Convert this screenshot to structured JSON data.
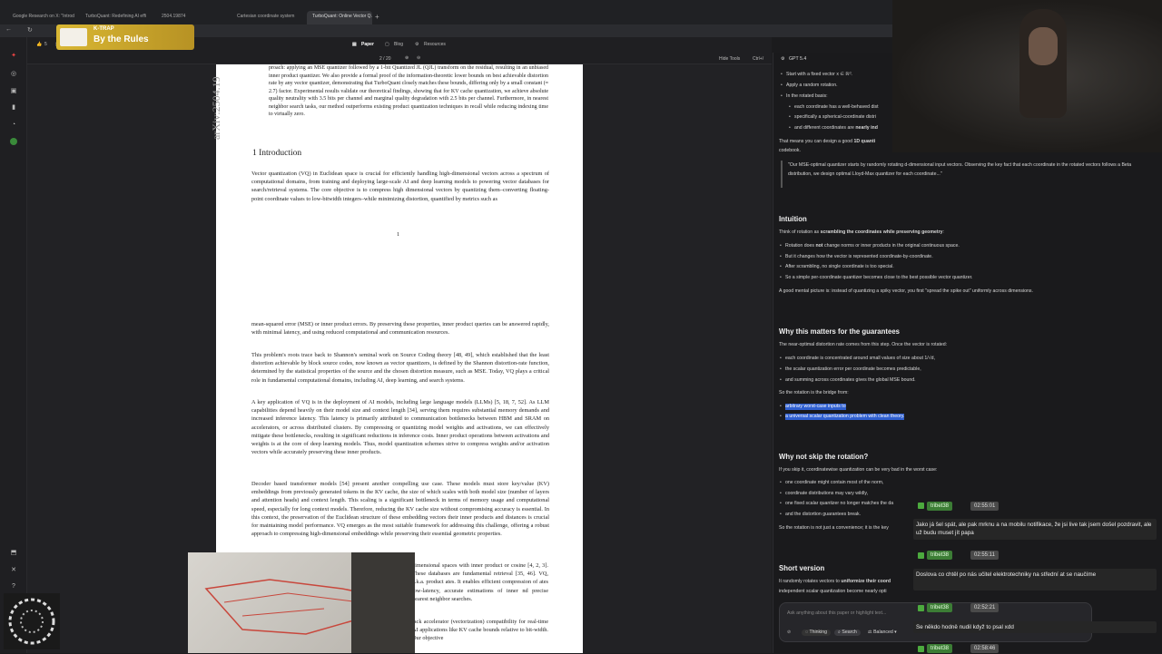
{
  "browser": {
    "tabs": [
      {
        "label": "Google Research on X: \"Introd"
      },
      {
        "label": "TurboQuant: Redefining AI effi"
      },
      {
        "label": "2504.19874"
      },
      {
        "label": "Cartesian coordinate system"
      },
      {
        "label": "TurboQuant: Online Vector Q..."
      }
    ],
    "new_tab_label": "+"
  },
  "overlay": {
    "brand": "K-TRAP",
    "subtitle": "By the Rules"
  },
  "viewer": {
    "tabs": [
      "Paper",
      "Blog",
      "Resources"
    ],
    "page_indicator": "2 / 20",
    "toolbar_count": "5",
    "hide_tools": "Hide Tools",
    "hide_tools_shortcut": "Ctrl+/",
    "arxiv_stamp": "arXiv:2504.19"
  },
  "paper": {
    "abstract_tail": "proach: applying an MSE quantizer followed by a 1-bit Quantized JL (QJL) transform on the residual, resulting in an unbiased inner product quantizer. We also provide a formal proof of the information-theoretic lower bounds on best achievable distortion rate by any vector quantizer, demonstrating that TurboQuant closely matches these bounds, differing only by a small constant (≈ 2.7) factor. Experimental results validate our theoretical findings, showing that for KV cache quantization, we achieve absolute quality neutrality with 3.5 bits per channel and marginal quality degradation with 2.5 bits per channel. Furthermore, in nearest neighbor search tasks, our method outperforms existing product quantization techniques in recall while reducing indexing time to virtually zero.",
    "section_title": "1   Introduction",
    "intro_p1": "Vector quantization (VQ) in Euclidean space is crucial for efficiently handling high-dimensional vectors across a spectrum of computational domains, from training and deploying large-scale AI and deep learning models to powering vector databases for search/retrieval systems. The core objective is to compress high dimensional vectors by quantizing them–converting floating-point coordinate values to low-bitwidth integers–while minimizing distortion, quantified by metrics such as",
    "page_number": "1",
    "p2": "mean-squared error (MSE) or inner product errors. By preserving these properties, inner product queries can be answered rapidly, with minimal latency, and using reduced computational and communication resources.",
    "p3": "This problem's roots trace back to Shannon's seminal work on Source Coding theory [48, 49], which established that the least distortion achievable by block source codes, now known as vector quantizers, is defined by the Shannon distortion-rate function, determined by the statistical properties of the source and the chosen distortion measure, such as MSE. Today, VQ plays a critical role in fundamental computational domains, including AI, deep learning, and search systems.",
    "p4": "A key application of VQ is in the deployment of AI models, including large language models (LLMs) [5, 18, 7, 52]. As LLM capabilities depend heavily on their model size and context length [34], serving them requires substantial memory demands and increased inference latency. This latency is primarily attributed to communication bottlenecks between HBM and SRAM on accelerators, or across distributed clusters. By compressing or quantizing model weights and activations, we can effectively mitigate these bottlenecks, resulting in significant reductions in inference costs. Inner product operations between activations and weights is at the core of deep learning models. Thus, model quantization schemes strive to compress weights and/or activation vectors while accurately preserving these inner products.",
    "p5": "Decoder based transformer models [54] present another compelling use case. These models must store key/value (KV) embeddings from previously generated tokens in the KV cache, the size of which scales with both model size (number of layers and attention heads) and context length. This scaling is a significant bottleneck in terms of memory usage and computational speed, especially for long context models. Therefore, reducing the KV cache size without compromising accuracy is essential. In this context, the preservation of the Euclidean structure of these embedding vectors their inner products and distances is crucial for maintaining model performance. VQ emerges as the most suitable framework for addressing this challenge, offering a robust approach to compressing high-dimensional embeddings while preserving their essential geometric properties.",
    "p6": "dimensional spaces with inner product or cosine [4, 2, 3]. These databases are fundamental retrieval [35, 46]. VQ, a.k.a. product ates. It enables efficient compression of ates low-latency, accurate estimations of inner nd precise nearest neighbor searches.",
    "p7": "lack accelerator (vectorization) compatibility for real-time AI applications like KV cache bounds relative to bit-width. Our objective"
  },
  "chat": {
    "model": "GPT 5.4",
    "l1": "Start with a fixed vector x ∈ ℝᵈ.",
    "l2": "Apply a random rotation.",
    "l3": "In the rotated basis:",
    "l4": "each coordinate has a well-behaved dist",
    "l5": "specifically a spherical-coordinate distri",
    "l6a": "and different coordinates are ",
    "l6b": "nearly ind",
    "l7a": "That means you can design a good ",
    "l7b": "1D quanti",
    "l8": "codebook.",
    "quote": "\"Our MSE-optimal quantizer starts by randomly rotating d-dimensional input vectors. Observing the key fact that each coordinate in the rotated vectors follows a Beta distribution, we design optimal Lloyd-Max quantizer for each coordinate...\"",
    "h_intuition": "Intuition",
    "i1a": "Think of rotation as ",
    "i1b": "scrambling the coordinates while preserving geometry",
    "i1c": ":",
    "i2a": "Rotation does ",
    "i2b": "not",
    "i2c": " change norms or inner products in the original continuous space.",
    "i3": "But it changes how the vector is represented coordinate-by-coordinate.",
    "i4": "After scrambling, no single coordinate is too special.",
    "i5": "So a simple per-coordinate quantizer becomes close to the best possible vector quantizer.",
    "i6": "A good mental picture is: instead of quantizing a spiky vector, you first \"spread the spike out\" uniformly across dimensions.",
    "h_why": "Why this matters for the guarantees",
    "w1": "The near-optimal distortion rate comes from this step. Once the vector is rotated:",
    "w2": "each coordinate is concentrated around small values of size about 1/√d,",
    "w3": "the scalar quantization error per coordinate becomes predictable,",
    "w4": "and summing across coordinates gives the global MSE bound.",
    "w5": "So the rotation is the bridge from:",
    "w6": "arbitrary worst-case inputs to",
    "w7": "a universal scalar quantization problem with clean theory.",
    "h_skip": "Why not skip the rotation?",
    "s1": "If you skip it, coordinatewise quantization can be very bad in the worst case:",
    "s2": "one coordinate might contain most of the norm,",
    "s3": "coordinate distributions may vary wildly,",
    "s4": "one fixed scalar quantizer no longer matches the da",
    "s5": "and the distortion guarantees break.",
    "s6": "So the rotation is not just a convenience; it is the key",
    "h_short": "Short version",
    "sv1a": "It randomly rotates vectors to ",
    "sv1b": "uniformize their coord",
    "sv2": "independent scalar quantization become nearly opti",
    "ask_placeholder": "Ask anything about this paper or highlight text...",
    "btn_thinking": "Thinking",
    "btn_search": "Search",
    "btn_balanced": "Balanced"
  },
  "stream_chat": [
    {
      "user": "tribet38",
      "time": "02:55:01",
      "message": "Jako já šel spát, ale pak mrknu a na mobilu notifikace, že jsi live tak jsem došel pozdravit, ale už budu muset jít papa"
    },
    {
      "user": "tribet38",
      "time": "02:55:11",
      "message": "Doslova co chtěl po nás učitel elektrotechniky na střední at se naučíme"
    },
    {
      "user": "tribet38",
      "time": "02:52:21",
      "message": "Se někdo hodně nudil když to psal xdd"
    },
    {
      "user": "tribet38",
      "time": "02:58:46",
      "message": ""
    }
  ],
  "colors": {
    "accent": "#2f5fd0",
    "chat_user": "#3c7d35",
    "banner": "#d9b733"
  }
}
